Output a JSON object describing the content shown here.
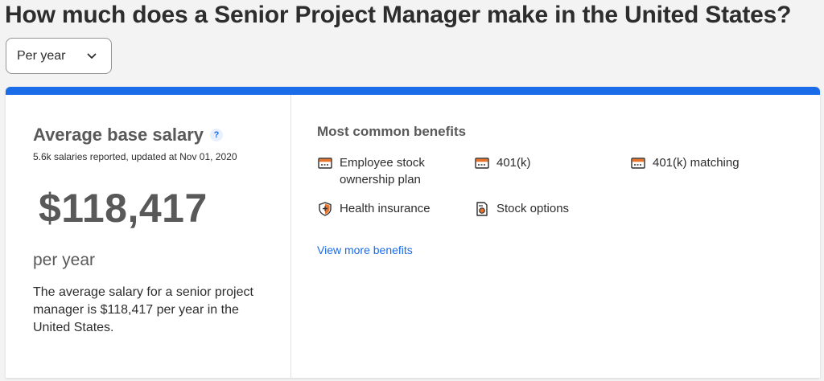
{
  "header": {
    "title": "How much does a Senior Project Manager make in the United States?"
  },
  "period_select": {
    "value": "Per year",
    "icon": "chevron-down-icon"
  },
  "salary_panel": {
    "heading": "Average base salary",
    "help_icon_text": "?",
    "meta": "5.6k salaries reported, updated at Nov 01, 2020",
    "amount": "$118,417",
    "period": "per year",
    "description": "The average salary for a senior project manager is $118,417 per year in the United States."
  },
  "benefits_panel": {
    "heading": "Most common benefits",
    "items": [
      {
        "label": "Employee stock ownership plan",
        "icon": "briefcase-icon"
      },
      {
        "label": "401(k)",
        "icon": "briefcase-icon"
      },
      {
        "label": "401(k) matching",
        "icon": "briefcase-icon"
      },
      {
        "label": "Health insurance",
        "icon": "shield-icon"
      },
      {
        "label": "Stock options",
        "icon": "document-icon"
      }
    ],
    "view_more": "View more benefits"
  },
  "colors": {
    "accent_blue": "#1a6ce8",
    "icon_orange": "#e8732a",
    "text_dark": "#2d2d2d",
    "text_gray": "#595959",
    "background": "#f3f3f3"
  }
}
